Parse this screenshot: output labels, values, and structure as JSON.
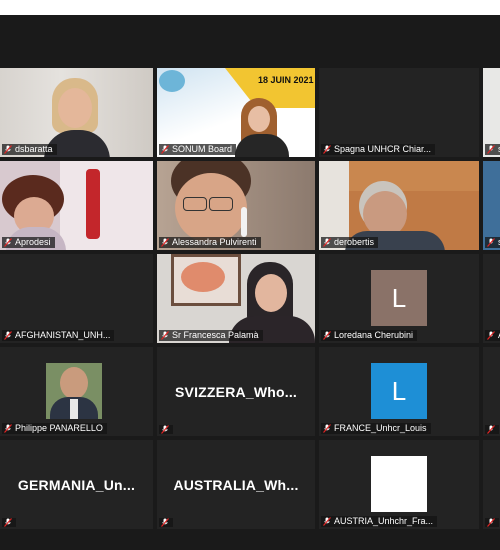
{
  "meeting": {
    "tiles": [
      {
        "id": "dsbaratta",
        "name": "dsbaratta"
      },
      {
        "id": "sonum",
        "name": "SONUM Board",
        "poster_date": "18 JUIN 2021"
      },
      {
        "id": "spagna",
        "name": "Spagna UNHCR Chiar..."
      },
      {
        "id": "aprodesi",
        "name": "Aprodesi"
      },
      {
        "id": "alessandra",
        "name": "Alessandra Pulvirenti"
      },
      {
        "id": "derobertis",
        "name": "derobertis"
      },
      {
        "id": "afghanistan",
        "name": "AFGHANISTAN_UNH..."
      },
      {
        "id": "francesca",
        "name": "Sr Francesca Palamà"
      },
      {
        "id": "loredana",
        "name": "Loredana Cherubini",
        "avatar_letter": "L",
        "avatar_color": "#8a7268"
      },
      {
        "id": "philippe",
        "name": "Philippe PANARELLO"
      },
      {
        "id": "svizzera",
        "name": "",
        "big_name": "SVIZZERA_Who..."
      },
      {
        "id": "france",
        "name": "FRANCE_Unhcr_Louis",
        "avatar_letter": "L",
        "avatar_color": "#1e8fd6"
      },
      {
        "id": "germania",
        "name": "",
        "big_name": "GERMANIA_Un..."
      },
      {
        "id": "australia",
        "name": "",
        "big_name": "AUSTRALIA_Wh..."
      },
      {
        "id": "austria",
        "name": "AUSTRIA_Unhchr_Fra..."
      }
    ],
    "edge_labels": [
      "s",
      "s",
      "A"
    ]
  }
}
